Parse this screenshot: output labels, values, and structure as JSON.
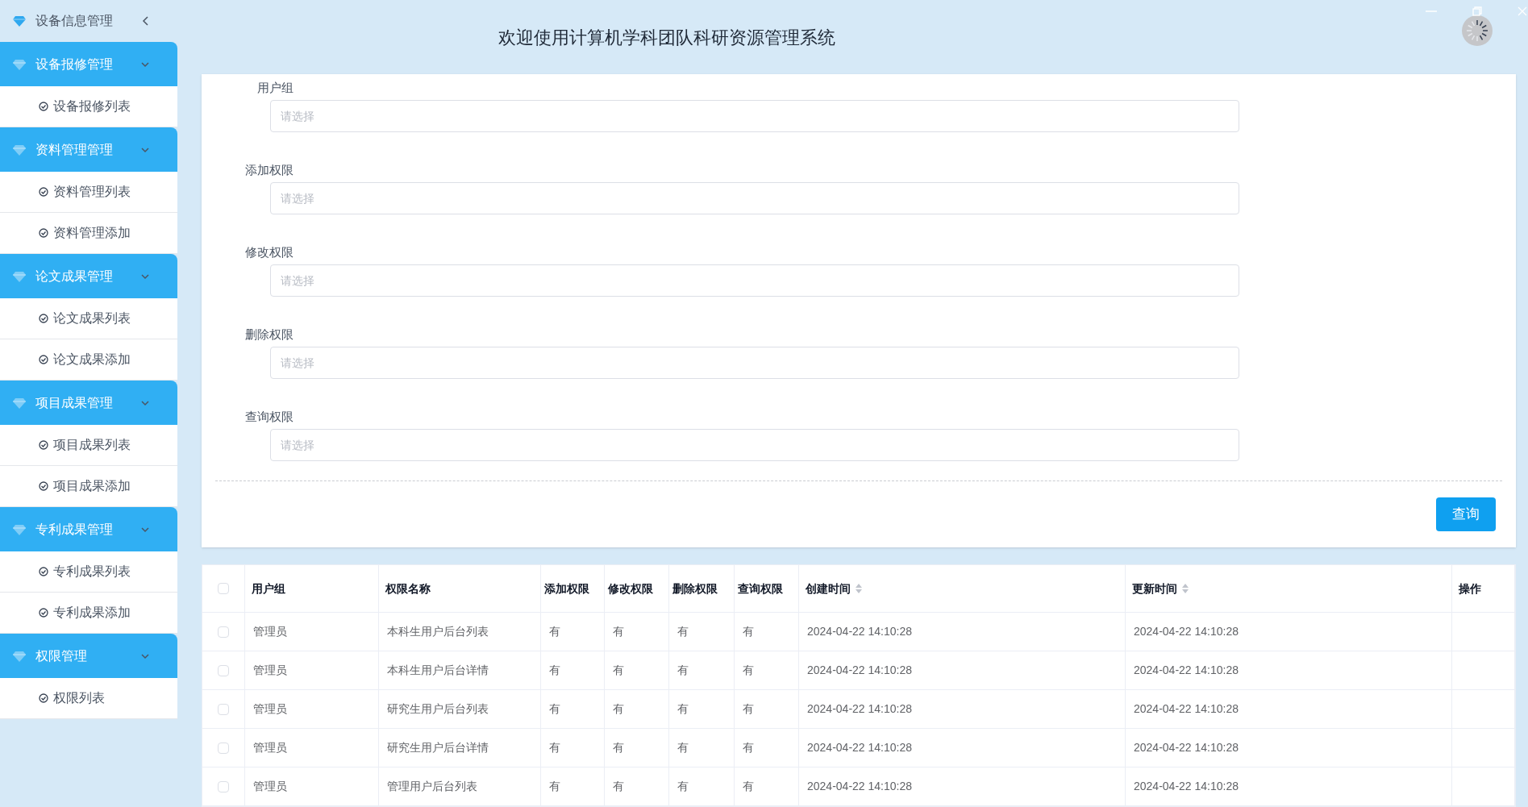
{
  "sidebar": {
    "title": "设备信息管理",
    "groups": [
      {
        "label": "设备报修管理",
        "expanded": true,
        "items": [
          "设备报修列表"
        ]
      },
      {
        "label": "资料管理管理",
        "expanded": true,
        "items": [
          "资料管理列表",
          "资料管理添加"
        ]
      },
      {
        "label": "论文成果管理",
        "expanded": true,
        "items": [
          "论文成果列表",
          "论文成果添加"
        ]
      },
      {
        "label": "项目成果管理",
        "expanded": true,
        "items": [
          "项目成果列表",
          "项目成果添加"
        ]
      },
      {
        "label": "专利成果管理",
        "expanded": true,
        "items": [
          "专利成果列表",
          "专利成果添加"
        ]
      },
      {
        "label": "权限管理",
        "expanded": true,
        "items": [
          "权限列表"
        ]
      }
    ]
  },
  "header": {
    "title": "欢迎使用计算机学科团队科研资源管理系统"
  },
  "search_form": {
    "fields": [
      {
        "label": "用户组",
        "placeholder": "请选择"
      },
      {
        "label": "添加权限",
        "placeholder": "请选择"
      },
      {
        "label": "修改权限",
        "placeholder": "请选择"
      },
      {
        "label": "删除权限",
        "placeholder": "请选择"
      },
      {
        "label": "查询权限",
        "placeholder": "请选择"
      }
    ],
    "button": "查询"
  },
  "table": {
    "select_all_checked": false,
    "columns": [
      {
        "label": "用户组",
        "sortable": false
      },
      {
        "label": "权限名称",
        "sortable": false
      },
      {
        "label": "添加权限",
        "sortable": false
      },
      {
        "label": "修改权限",
        "sortable": false
      },
      {
        "label": "删除权限",
        "sortable": false
      },
      {
        "label": "查询权限",
        "sortable": false
      },
      {
        "label": "创建时间",
        "sortable": true
      },
      {
        "label": "更新时间",
        "sortable": true
      },
      {
        "label": "操作",
        "sortable": false
      }
    ],
    "rows": [
      {
        "checked": false,
        "cells": [
          "管理员",
          "本科生用户后台列表",
          "有",
          "有",
          "有",
          "有",
          "2024-04-22 14:10:28",
          "2024-04-22 14:10:28",
          ""
        ]
      },
      {
        "checked": false,
        "cells": [
          "管理员",
          "本科生用户后台详情",
          "有",
          "有",
          "有",
          "有",
          "2024-04-22 14:10:28",
          "2024-04-22 14:10:28",
          ""
        ]
      },
      {
        "checked": false,
        "cells": [
          "管理员",
          "研究生用户后台列表",
          "有",
          "有",
          "有",
          "有",
          "2024-04-22 14:10:28",
          "2024-04-22 14:10:28",
          ""
        ]
      },
      {
        "checked": false,
        "cells": [
          "管理员",
          "研究生用户后台详情",
          "有",
          "有",
          "有",
          "有",
          "2024-04-22 14:10:28",
          "2024-04-22 14:10:28",
          ""
        ]
      },
      {
        "checked": false,
        "cells": [
          "管理员",
          "管理用户后台列表",
          "有",
          "有",
          "有",
          "有",
          "2024-04-22 14:10:28",
          "2024-04-22 14:10:28",
          ""
        ]
      }
    ]
  }
}
